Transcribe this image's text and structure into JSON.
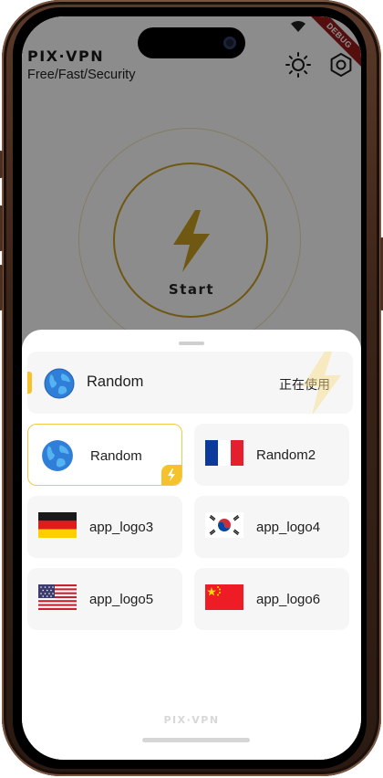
{
  "app": {
    "brand": "PIX·VPN",
    "tagline": "Free/Fast/Security",
    "debug_banner": "DEBUG"
  },
  "main": {
    "start_label": "Start"
  },
  "sheet": {
    "current": {
      "name": "Random",
      "status": "正在使用",
      "icon": "globe-icon"
    },
    "servers": [
      {
        "name": "Random",
        "icon": "globe-icon",
        "selected": true
      },
      {
        "name": "Random2",
        "icon": "france-flag-icon",
        "selected": false
      },
      {
        "name": "app_logo3",
        "icon": "germany-flag-icon",
        "selected": false
      },
      {
        "name": "app_logo4",
        "icon": "south-korea-flag-icon",
        "selected": false
      },
      {
        "name": "app_logo5",
        "icon": "usa-flag-icon",
        "selected": false
      },
      {
        "name": "app_logo6",
        "icon": "china-flag-icon",
        "selected": false
      }
    ],
    "footer_brand": "PIX·VPN"
  },
  "colors": {
    "accent": "#f5c22b",
    "debug_ribbon": "#9a1b1b"
  }
}
